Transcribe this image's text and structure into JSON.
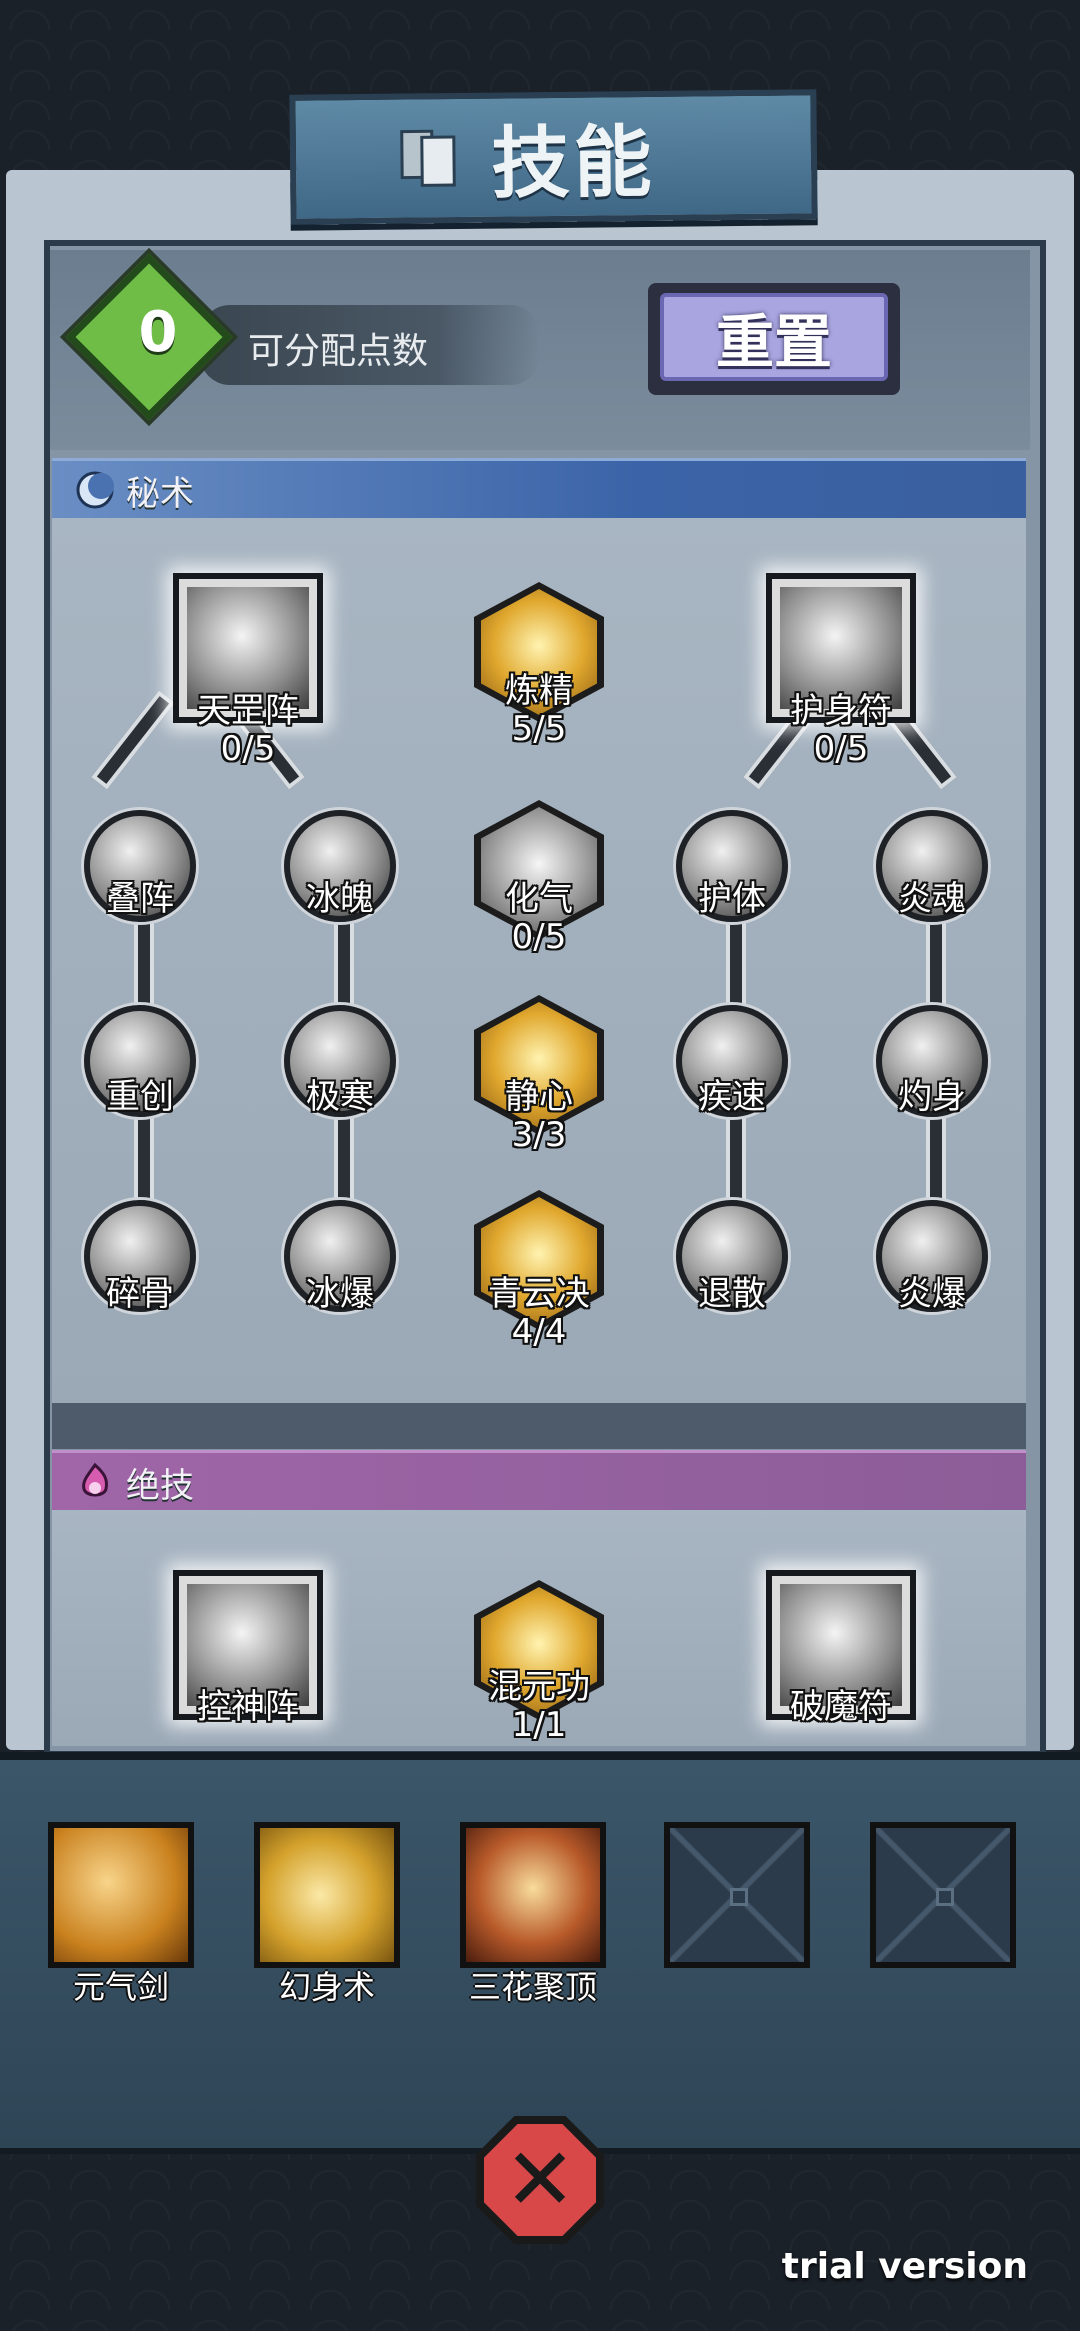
{
  "title": "技能",
  "points": {
    "value": "0",
    "label": "可分配点数"
  },
  "reset_label": "重置",
  "sections": {
    "arcana": "秘术",
    "ultimate": "绝技"
  },
  "tree": {
    "top_left": {
      "name": "天罡阵",
      "progress": "0/5"
    },
    "top_center": {
      "name": "炼精",
      "progress": "5/5"
    },
    "top_right": {
      "name": "护身符",
      "progress": "0/5"
    },
    "row2": [
      {
        "name": "叠阵"
      },
      {
        "name": "冰魄"
      },
      {
        "name": "化气",
        "progress": "0/5"
      },
      {
        "name": "护体"
      },
      {
        "name": "炎魂"
      }
    ],
    "row3": [
      {
        "name": "重创"
      },
      {
        "name": "极寒"
      },
      {
        "name": "静心",
        "progress": "3/3"
      },
      {
        "name": "疾速"
      },
      {
        "name": "灼身"
      }
    ],
    "row4": [
      {
        "name": "碎骨"
      },
      {
        "name": "冰爆"
      },
      {
        "name": "青云决",
        "progress": "4/4"
      },
      {
        "name": "退散"
      },
      {
        "name": "炎爆"
      }
    ]
  },
  "ultimate": [
    {
      "name": "控神阵"
    },
    {
      "name": "混元功",
      "progress": "1/1"
    },
    {
      "name": "破魔符"
    }
  ],
  "equipped": [
    {
      "name": "元气剑",
      "icon": "sword-qi-icon"
    },
    {
      "name": "幻身术",
      "icon": "cloud-illusion-icon"
    },
    {
      "name": "三花聚顶",
      "icon": "lotus-icon"
    },
    {
      "name": "",
      "icon": "empty-slot-icon"
    },
    {
      "name": "",
      "icon": "empty-slot-icon"
    }
  ],
  "trial_label": "trial version"
}
